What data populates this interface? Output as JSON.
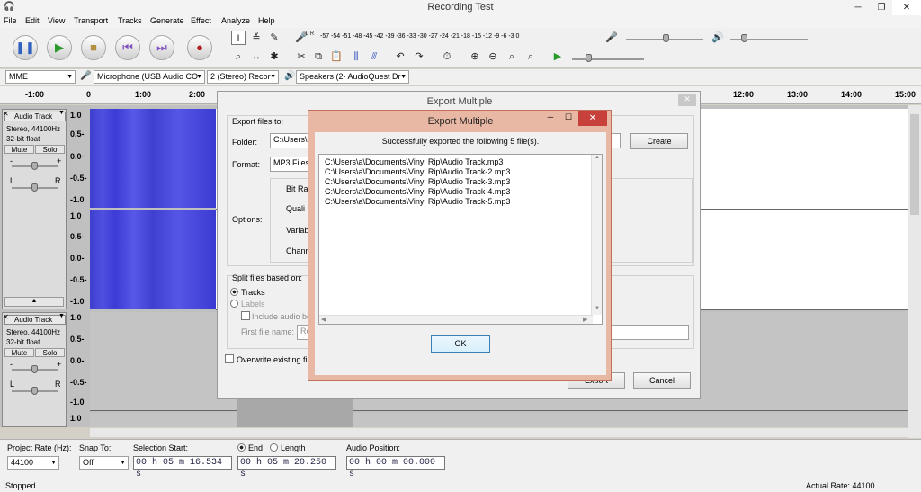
{
  "window": {
    "title": "Recording Test",
    "min": "─",
    "max": "❐",
    "close": "✕"
  },
  "menu": [
    "File",
    "Edit",
    "View",
    "Transport",
    "Tracks",
    "Generate",
    "Effect",
    "Analyze",
    "Help"
  ],
  "meter": {
    "lr": "L R",
    "scale": "-57 -54 -51 -48 -45 -42 -39 -36 -33 -30 -27 -24 -21 -18 -15 -12 -9 -6 -3 0"
  },
  "devices": {
    "host": "MME",
    "input": "Microphone (USB Audio CO",
    "channels": "2 (Stereo) Recor",
    "output": "Speakers (2- AudioQuest Dr"
  },
  "ruler": [
    "-1:00",
    "0",
    "1:00",
    "2:00",
    "12:00",
    "13:00",
    "14:00",
    "15:00"
  ],
  "tracks": [
    {
      "name": "Audio Track",
      "rate": "Stereo, 44100Hz",
      "fmt": "32-bit float",
      "mute": "Mute",
      "solo": "Solo",
      "lbl_l": "L",
      "lbl_r": "R",
      "lbl_minus": "-",
      "lbl_plus": "+"
    },
    {
      "name": "Audio Track",
      "rate": "Stereo, 44100Hz",
      "fmt": "32-bit float",
      "mute": "Mute",
      "solo": "Solo",
      "lbl_l": "L",
      "lbl_r": "R",
      "lbl_minus": "-",
      "lbl_plus": "+"
    }
  ],
  "scales": [
    "1.0",
    "0.5-",
    "0.0-",
    "-0.5-",
    "-1.0",
    "1.0",
    "0.5-",
    "0.0-",
    "-0.5-",
    "-1.0",
    "1.0",
    "0.5-",
    "0.0-",
    "-0.5-",
    "-1.0",
    "1.0"
  ],
  "selection": {
    "project_rate_label": "Project Rate (Hz):",
    "project_rate": "44100",
    "snap_label": "Snap To:",
    "snap": "Off",
    "start_label": "Selection Start:",
    "start": "00 h 05 m 16.534 s",
    "end_label": "End",
    "length_label": "Length",
    "end": "00 h 05 m 20.250 s",
    "pos_label": "Audio Position:",
    "pos": "00 h 00 m 00.000 s"
  },
  "status": {
    "left": "Stopped.",
    "right": "Actual Rate: 44100"
  },
  "export_back": {
    "title": "Export Multiple",
    "close": "✕",
    "export_to": "Export files to:",
    "folder_label": "Folder:",
    "folder": "C:\\Users\\a",
    "create": "Create",
    "format_label": "Format:",
    "format": "MP3 Files",
    "options_label": "Options:",
    "opt1": "Bit Rat",
    "opt2": "Quali",
    "opt3": "Variab",
    "opt4": "Chann",
    "split_label": "Split files based on:",
    "tracks": "Tracks",
    "labels": "Labels",
    "include_audio": "Include audio be",
    "first_file": "First file name:",
    "first_file_val": "Re",
    "overwrite": "Overwrite existing fil",
    "export": "Export",
    "cancel": "Cancel"
  },
  "dialog": {
    "title": "Export Multiple",
    "min": "─",
    "max": "☐",
    "close": "✕",
    "message": "Successfully exported the following 5 file(s).",
    "files": [
      "C:\\Users\\a\\Documents\\Vinyl Rip\\Audio Track.mp3",
      "C:\\Users\\a\\Documents\\Vinyl Rip\\Audio Track-2.mp3",
      "C:\\Users\\a\\Documents\\Vinyl Rip\\Audio Track-3.mp3",
      "C:\\Users\\a\\Documents\\Vinyl Rip\\Audio Track-4.mp3",
      "C:\\Users\\a\\Documents\\Vinyl Rip\\Audio Track-5.mp3"
    ],
    "ok": "OK"
  },
  "colors": {
    "wave": "#4646dc",
    "close_red": "#c7403a",
    "dialog_frame": "#e9b8a4"
  }
}
